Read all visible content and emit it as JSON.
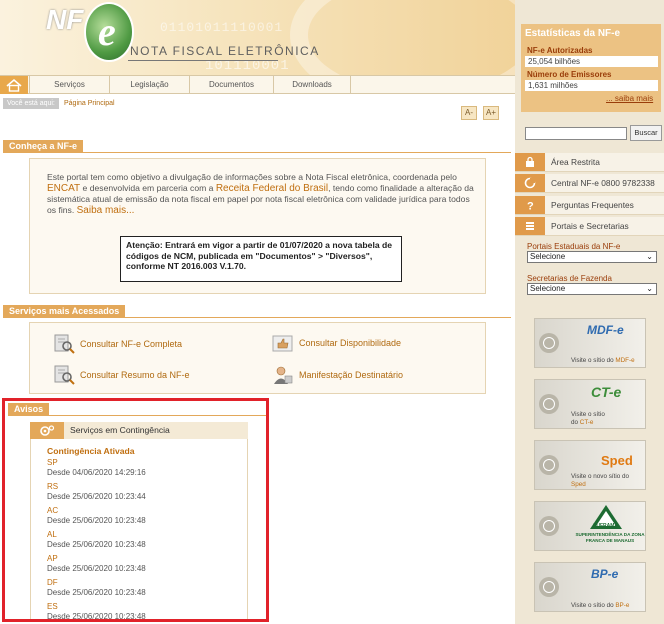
{
  "header": {
    "site_title": "NOTA FISCAL ELETRÔNICA",
    "logo_nf": "NF",
    "logo_e": "e",
    "decor_bits_top": "01101011110001",
    "decor_bits_bottom": "101110001"
  },
  "nav": {
    "items": [
      {
        "label": "Serviços"
      },
      {
        "label": "Legislação"
      },
      {
        "label": "Documentos"
      },
      {
        "label": "Downloads"
      }
    ]
  },
  "breadcrumb": {
    "label": "Você está aqui:",
    "link": "Página Principal"
  },
  "font_controls": {
    "decrease": "A-",
    "increase": "A+"
  },
  "intro": {
    "tab": "Conheça a NF-e",
    "text1": "Este portal tem como objetivo a divulgação de informações sobre a Nota Fiscal eletrônica, coordenada pelo ",
    "link1": "ENCAT",
    "text2": " e desenvolvida em parceria com a ",
    "link2": "Receita Federal do Brasil",
    "text3": ", tendo como finalidade a alteração da sistemática atual de emissão da nota fiscal em papel por nota fiscal eletrônica com validade jurídica para todos os fins. ",
    "link3": "Saiba mais...",
    "notice": "Atenção: Entrará em vigor a partir de 01/07/2020 a nova tabela de códigos de NCM, publicada em \"Documentos\" > \"Diversos\", conforme NT 2016.003 V.1.70."
  },
  "services": {
    "tab": "Serviços mais Acessados",
    "items": [
      {
        "label": "Consultar NF-e Completa",
        "icon": "document-search-icon"
      },
      {
        "label": "Consultar Disponibilidade",
        "icon": "thumbs-up-icon"
      },
      {
        "label": "Consultar Resumo da NF-e",
        "icon": "document-search-icon"
      },
      {
        "label": "Manifestação Destinatário",
        "icon": "person-icon"
      }
    ]
  },
  "avisos": {
    "tab": "Avisos",
    "card_title": "Serviços em Contingência",
    "heading": "Contingência Ativada",
    "items": [
      {
        "uf": "SP",
        "date": "Desde 04/06/2020 14:29:16"
      },
      {
        "uf": "RS",
        "date": "Desde 25/06/2020 10:23:44"
      },
      {
        "uf": "AC",
        "date": "Desde 25/06/2020 10:23:48"
      },
      {
        "uf": "AL",
        "date": "Desde 25/06/2020 10:23:48"
      },
      {
        "uf": "AP",
        "date": "Desde 25/06/2020 10:23:48"
      },
      {
        "uf": "DF",
        "date": "Desde 25/06/2020 10:23:48"
      },
      {
        "uf": "ES",
        "date": "Desde 25/06/2020 10:23:48"
      }
    ]
  },
  "stats": {
    "title": "Estatísticas da NF-e",
    "authorized_label": "NF-e Autorizadas",
    "authorized_value": "25,054 bilhões",
    "issuers_label": "Número de Emissores",
    "issuers_value": "1,631 milhões",
    "more_link": "... saiba mais"
  },
  "search": {
    "button": "Buscar",
    "value": ""
  },
  "sidebar": {
    "rows": [
      {
        "label": "Área Restrita",
        "icon": "lock-icon"
      },
      {
        "label": "Central NF-e 0800 9782338",
        "icon": "phone-icon"
      },
      {
        "label": "Perguntas Frequentes",
        "icon": "question-icon"
      },
      {
        "label": "Portais e Secretarias",
        "icon": "list-icon"
      }
    ],
    "portals_label": "Portais Estaduais da NF-e",
    "portals_selected": "Selecione",
    "secretarias_label": "Secretarias de Fazenda",
    "secretarias_selected": "Selecione"
  },
  "banners": [
    {
      "logo": "MDF-e",
      "pre": "Visite o sítio do ",
      "link": "MDF-e",
      "color": "#2f6bb0"
    },
    {
      "logo": "CT-e",
      "pre": "Visite o sítio do ",
      "link": "CT-e",
      "color": "#3d8d3a"
    },
    {
      "logo": "Sped",
      "pre": "Visite o novo sítio do ",
      "link": "Sped",
      "color": "#e07a12"
    },
    {
      "logo": "SUFRAMA",
      "pre": "SUPERINTENDÊNCIA DA ZONA FRANCA DE MANAUS",
      "link": "",
      "color": "#1d6b32"
    },
    {
      "logo": "BP-e",
      "pre": "Visite o sítio do ",
      "link": "BP-e",
      "color": "#2f6bb0"
    }
  ]
}
